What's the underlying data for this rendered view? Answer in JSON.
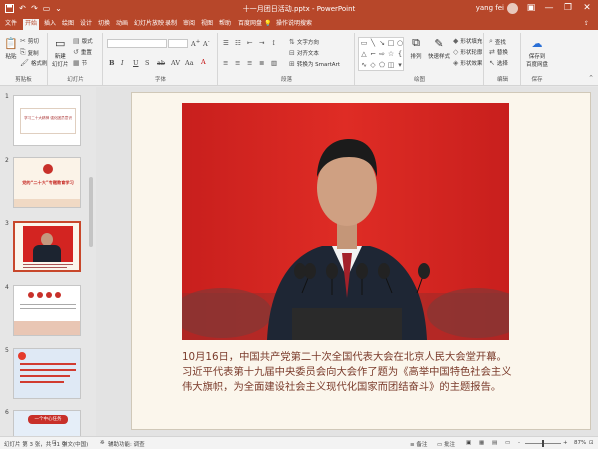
{
  "titlebar": {
    "title": "十一月团日活动.pptx - PowerPoint",
    "user": "yang fei",
    "min": "—",
    "restore": "❐",
    "close": "✕"
  },
  "tabs": [
    "文件",
    "开始",
    "插入",
    "绘图",
    "设计",
    "切换",
    "动画",
    "幻灯片放映",
    "录制",
    "审阅",
    "视图",
    "帮助",
    "百度网盘",
    "操作说明搜索"
  ],
  "ribbon": {
    "clipboard": {
      "paste": "粘贴",
      "cut": "剪切",
      "copy": "复制",
      "format_painter": "格式刷",
      "label": "剪贴板"
    },
    "slides": {
      "new_slide": "新建\n幻灯片",
      "layout": "版式",
      "reset": "重置",
      "section": "节",
      "label": "幻灯片"
    },
    "font": {
      "label": "字体",
      "bold": "B",
      "italic": "I",
      "underline": "U",
      "strike": "S",
      "font_color": "A"
    },
    "paragraph": {
      "text_direction": "文字方向",
      "align_text": "对齐文本",
      "smartart": "转换为 SmartArt",
      "label": "段落"
    },
    "drawing": {
      "arrange": "排列",
      "quick_styles": "快速样式",
      "fill": "形状填充",
      "outline": "形状轮廓",
      "effects": "形状效果",
      "label": "绘图"
    },
    "editing": {
      "find": "查找",
      "replace": "替换",
      "select": "选择",
      "label": "编辑"
    },
    "save": {
      "button": "保存到\n百度网盘",
      "label": "保存"
    }
  },
  "thumbnails": [
    {
      "num": "1",
      "title": "学习二十大精神 强化团员意识"
    },
    {
      "num": "2",
      "title": "党的“二十大”专题教育学习"
    },
    {
      "num": "3",
      "title": ""
    },
    {
      "num": "4",
      "title": ""
    },
    {
      "num": "5",
      "title": ""
    },
    {
      "num": "6",
      "title": "一个中心任务"
    }
  ],
  "slide": {
    "caption": "10月16日，中国共产党第二十次全国代表大会在北京人民大会堂开幕。习近平代表第十九届中央委员会向大会作了题为《高举中国特色社会主义伟大旗帜，为全面建设社会主义现代化国家而团结奋斗》的主题报告。"
  },
  "status": {
    "slide_info": "幻灯片 第 3 张，共 31 张",
    "language": "中文(中国)",
    "accessibility": "辅助功能: 调查",
    "notes": "备注",
    "comments": "批注",
    "zoom_minus": "-",
    "zoom_plus": "+",
    "zoom": "87%"
  },
  "colors": {
    "accent": "#b7472a",
    "slide_bg": "#fbf6ec",
    "caption": "#7a3a2a"
  }
}
